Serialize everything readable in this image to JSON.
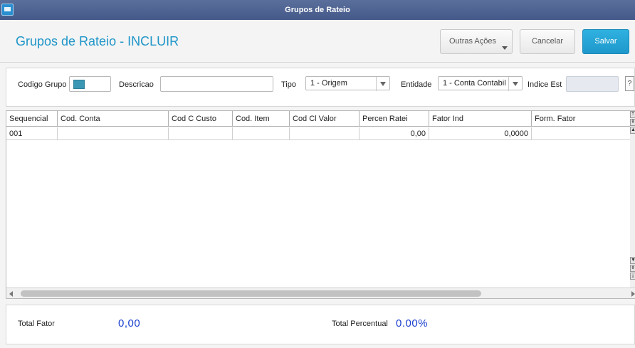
{
  "window": {
    "title": "Grupos de Rateio"
  },
  "header": {
    "page_title": "Grupos de Rateio - INCLUIR",
    "buttons": {
      "more": "Outras Ações",
      "cancel": "Cancelar",
      "save": "Salvar"
    }
  },
  "form": {
    "codigo_grupo": {
      "label": "Codigo Grupo",
      "value": ""
    },
    "descricao": {
      "label": "Descricao",
      "value": ""
    },
    "tipo": {
      "label": "Tipo",
      "value": "1 - Origem"
    },
    "entidade": {
      "label": "Entidade",
      "value": "1 - Conta Contabil"
    },
    "indice_est": {
      "label": "Indice Est",
      "value": "",
      "help": "?"
    }
  },
  "grid": {
    "columns": [
      "Sequencial",
      "Cod. Conta",
      "Cod C Custo",
      "Cod. Item",
      "Cod Cl Valor",
      "Percen Ratei",
      "Fator Ind",
      "Form. Fator"
    ],
    "rows": [
      [
        "001",
        "",
        "",
        "",
        "",
        "0,00",
        "0,0000",
        ""
      ]
    ]
  },
  "totals": {
    "total_fator": {
      "label": "Total Fator",
      "value": "0,00"
    },
    "total_percentual": {
      "label": "Total Percentual",
      "value": "0.00%"
    }
  },
  "colors": {
    "accent": "#1e95c8",
    "save_button": "#23a5d8",
    "titlebar": "#4f6492",
    "totals_value": "#1a3fd0"
  }
}
